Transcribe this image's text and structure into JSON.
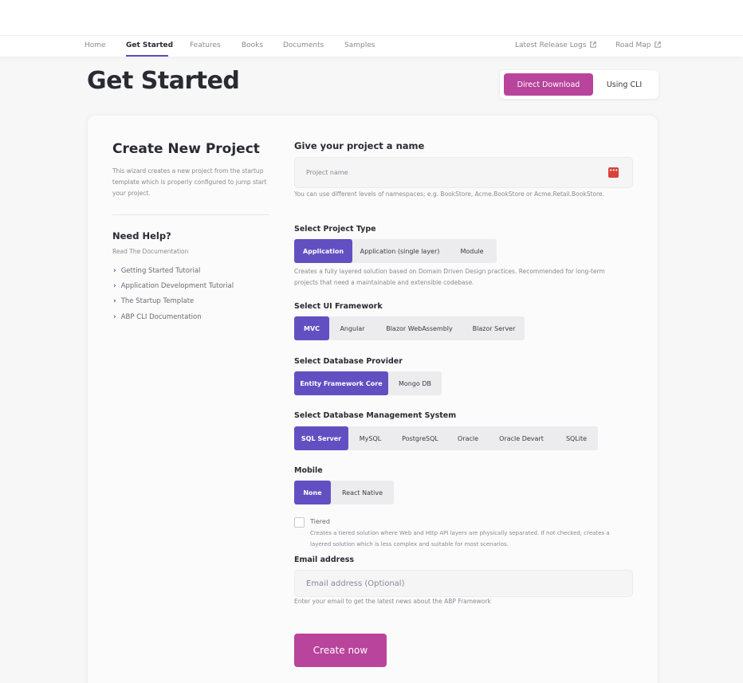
{
  "nav": {
    "items": [
      "Home",
      "Get Started",
      "Features",
      "Books",
      "Documents",
      "Samples"
    ],
    "active": "Get Started",
    "right_items": [
      "Latest Release Logs",
      "Road Map"
    ]
  },
  "page": {
    "title": "Get Started",
    "toggle": {
      "active": "Direct Download",
      "inactive": "Using CLI"
    }
  },
  "left": {
    "title": "Create New Project",
    "description": "This wizard creates a new project from the startup template which is properly configured to jump start your project.",
    "help_title": "Need Help?",
    "help_subtitle": "Read The Documentation",
    "links": [
      "Getting Started Tutorial",
      "Application Development Tutorial",
      "The Startup Template",
      "ABP CLI Documentation"
    ]
  },
  "form": {
    "name_label": "Give your project a name",
    "name_placeholder": "Project name",
    "name_hint": "You can use different levels of namespaces; e.g. BookStore, Acme.BookStore or Acme.Retail.BookStore.",
    "project_type": {
      "label": "Select Project Type",
      "options": [
        "Application",
        "Application (single layer)",
        "Module"
      ],
      "selected": "Application",
      "hint": "Creates a fully layered solution based on Domain Driven Design practices. Recommended for long-term projects that need a maintainable and extensible codebase."
    },
    "ui_framework": {
      "label": "Select UI Framework",
      "options": [
        "MVC",
        "Angular",
        "Blazor WebAssembly",
        "Blazor Server"
      ],
      "selected": "MVC"
    },
    "db_provider": {
      "label": "Select Database Provider",
      "options": [
        "Entity Framework Core",
        "Mongo DB"
      ],
      "selected": "Entity Framework Core"
    },
    "dbms": {
      "label": "Select Database Management System",
      "options": [
        "SQL Server",
        "MySQL",
        "PostgreSQL",
        "Oracle",
        "Oracle Devart",
        "SQLite"
      ],
      "selected": "SQL Server"
    },
    "mobile": {
      "label": "Mobile",
      "options": [
        "None",
        "React Native"
      ],
      "selected": "None"
    },
    "tiered": {
      "label": "Tiered",
      "checked": false,
      "description": "Creates a tiered solution where Web and Http API layers are physically separated. If not checked, creates a layered solution which is less complex and suitable for most scenarios."
    },
    "email": {
      "label": "Email address",
      "placeholder": "Email address (Optional)",
      "hint": "Enter your email to get the latest news about the ABP Framework"
    },
    "submit_label": "Create now"
  },
  "colors": {
    "brand_pink": "#b8449b",
    "brand_purple": "#6250c2",
    "nav_underline": "#5b4bbd"
  }
}
